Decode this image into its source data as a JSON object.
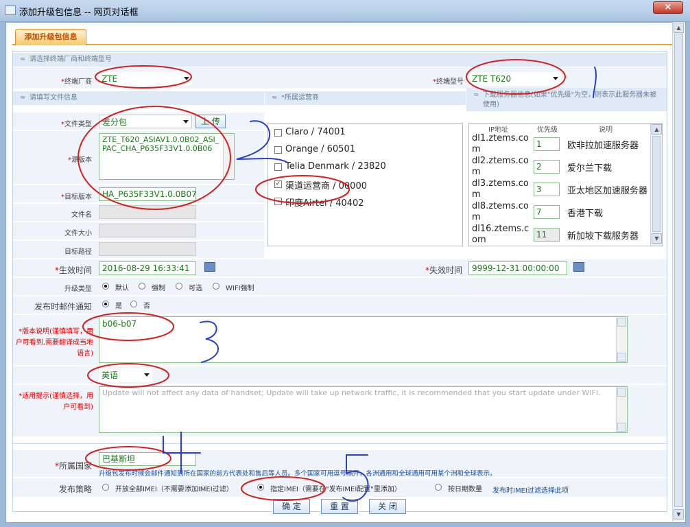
{
  "window": {
    "title": "添加升级包信息 -- 网页对话框",
    "close": "×"
  },
  "tab": {
    "label": "添加升级包信息"
  },
  "sections": {
    "vendor_model": "请选择终端厂商和终端型号",
    "file_info": "请填写文件信息",
    "operator": "*所属运营商",
    "server": "下载服务器信息(如果\"优先级\"为空，则表示此服务器未被使用)"
  },
  "vendor": {
    "label": "终端厂商",
    "value": "ZTE"
  },
  "model": {
    "label": "终端型号",
    "value": "ZTE T620"
  },
  "file_type": {
    "label": "文件类型",
    "value": "差分包",
    "upload": "上 传"
  },
  "source_version": {
    "label": "源版本",
    "value": "ZTE_T620_ASIAV1.0.0B02_ASI_PAC_CHA_P635F33V1.0.0B06"
  },
  "target_version": {
    "label": "目标版本",
    "value": "HA_P635F33V1.0.0B07"
  },
  "file_name": {
    "label": "文件名"
  },
  "file_size": {
    "label": "文件大小"
  },
  "target_path": {
    "label": "目标路径"
  },
  "operators": [
    {
      "name": "Claro / 74001",
      "checked": false
    },
    {
      "name": "Orange / 60501",
      "checked": false
    },
    {
      "name": "Telia Denmark / 23820",
      "checked": false
    },
    {
      "name": "渠道运营商  / 00000",
      "checked": true
    },
    {
      "name": "印度Airtel / 40402",
      "checked": false
    }
  ],
  "servers": {
    "headers": [
      "IP地址",
      "优先级",
      "说明"
    ],
    "rows": [
      {
        "ip": "dl1.ztems.com",
        "prio": "1",
        "desc": "欧非拉加速服务器"
      },
      {
        "ip": "dl2.ztems.com",
        "prio": "2",
        "desc": "爱尔兰下载"
      },
      {
        "ip": "dl3.ztems.com",
        "prio": "3",
        "desc": "亚太地区加速服务器"
      },
      {
        "ip": "dl8.ztems.com",
        "prio": "7",
        "desc": "香港下载"
      },
      {
        "ip": "dl16.ztems.com",
        "prio": "11",
        "desc": "新加坡下载服务器"
      }
    ]
  },
  "effective_time": {
    "label": "生效时间",
    "value": "2016-08-29 16:33:41"
  },
  "expire_time": {
    "label": "失效时间",
    "value": "9999-12-31 00:00:00"
  },
  "upgrade_type": {
    "label": "升级类型",
    "options": [
      "默认",
      "强制",
      "可选",
      "WIFI强制"
    ],
    "selected": 0
  },
  "email_notify": {
    "label": "发布时邮件通知",
    "options": [
      "是",
      "否"
    ],
    "selected": 0
  },
  "version_desc": {
    "label": "*版本说明(谨慎填写，用户可看到,需要翻译成当地语言)",
    "value": "b06-b07"
  },
  "language": {
    "value": "英语"
  },
  "tip": {
    "label": "*适用提示(谨慎选择，用户可看到)",
    "value": "Update will not affect any data of handset; Update will take up network traffic, it is recommended that you start update under WIFI."
  },
  "country": {
    "label": "所属国家",
    "value": "巴基斯坦",
    "note": "升级包发布时候会邮件通知到所在国家的前方代表处和售后等人员。多个国家可用逗号隔开，各洲通用和全球通用可用某个洲和全球表示。"
  },
  "strategy": {
    "label": "发布策略",
    "options": [
      "开放全部IMEI（不需要添加IMEI过滤）",
      "指定IMEI（需要在\"发布IMEI配置\"里添加）",
      "按日期数量"
    ],
    "selected": 1,
    "note": "发布时IMEI过滤选择此项"
  },
  "buttons": {
    "ok": "确 定",
    "reset": "重 置",
    "close": "关 闭"
  },
  "annotations": {
    "n2": "2",
    "n3": "3",
    "n4": "4",
    "n5": "5"
  }
}
